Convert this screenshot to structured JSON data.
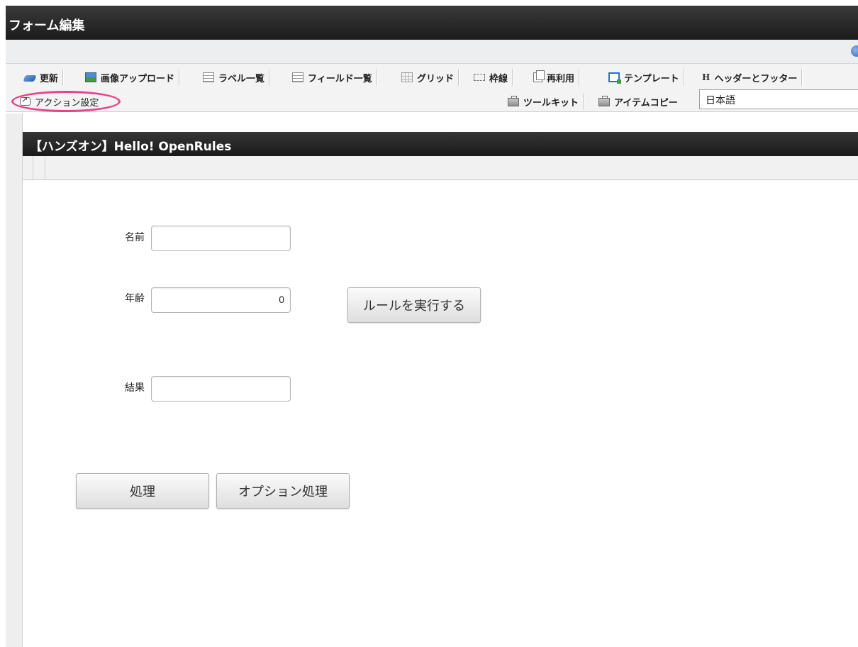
{
  "window": {
    "title": "フォーム編集"
  },
  "toolbar": {
    "row1": [
      {
        "label": "更新",
        "icon": "refresh-icon"
      },
      {
        "label": "画像アップロード",
        "icon": "image-upload-icon"
      },
      {
        "label": "ラベル一覧",
        "icon": "list-icon"
      },
      {
        "label": "フィールド一覧",
        "icon": "list-icon"
      },
      {
        "label": "グリッド",
        "icon": "grid-icon"
      },
      {
        "label": "枠線",
        "icon": "frame-icon"
      },
      {
        "label": "再利用",
        "icon": "copy-icon"
      },
      {
        "label": "テンプレート",
        "icon": "template-icon"
      },
      {
        "label": "ヘッダーとフッター",
        "icon": "header-footer-icon",
        "glyph": "H"
      }
    ],
    "action_settings": {
      "label": "アクション設定",
      "icon": "action-icon"
    },
    "toolkit": {
      "label": "ツールキット",
      "icon": "toolkit-icon"
    },
    "item_copy": {
      "label": "アイテムコピー",
      "icon": "toolkit-icon"
    },
    "language": {
      "selected": "日本語"
    }
  },
  "form": {
    "title": "【ハンズオン】Hello! OpenRules",
    "name_label": "名前",
    "name_value": "",
    "age_label": "年齢",
    "age_value": "0",
    "run_rules_button": "ルールを実行する",
    "result_label": "結果",
    "result_value": "",
    "process_button": "処理",
    "option_process_button": "オプション処理"
  },
  "colors": {
    "highlight_ring": "#e9428a",
    "title_bar": "#2a2a2a"
  }
}
